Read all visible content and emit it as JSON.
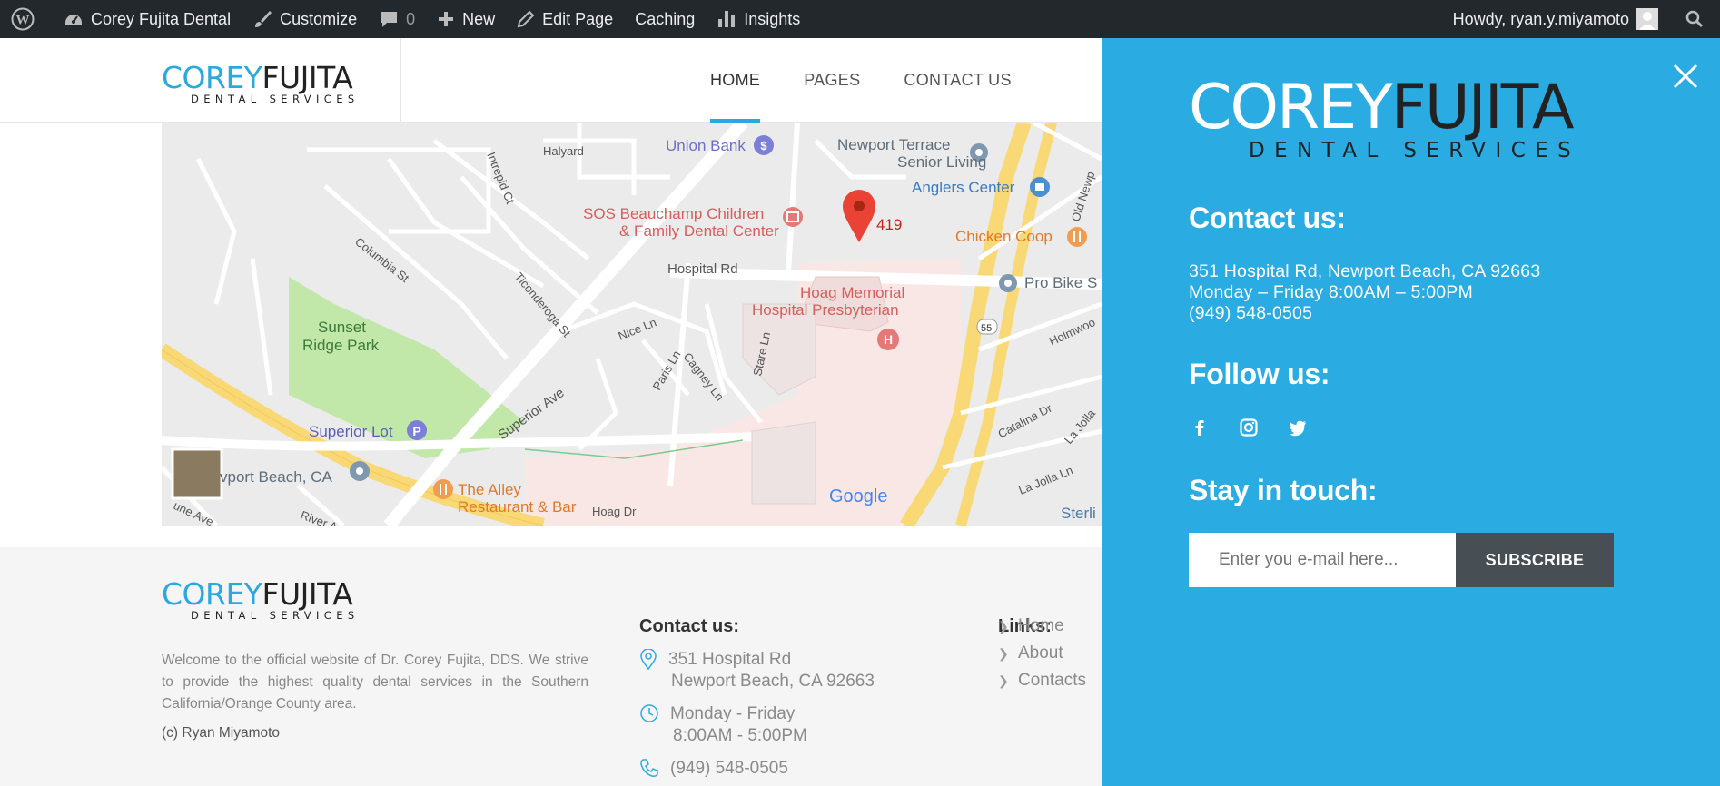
{
  "adminbar": {
    "site_name": "Corey Fujita Dental",
    "customize": "Customize",
    "comments_count": "0",
    "new": "New",
    "edit_page": "Edit Page",
    "caching": "Caching",
    "insights": "Insights",
    "howdy": "Howdy, ryan.y.miyamoto"
  },
  "logo": {
    "first": "COREY",
    "last": "FUJITA",
    "tagline": "DENTAL SERVICES"
  },
  "nav": {
    "items": [
      "HOME",
      "PAGES",
      "CONTACT US"
    ],
    "active": "HOME"
  },
  "map": {
    "labels": {
      "halyard": "Halyard",
      "union_bank": "Union Bank",
      "newport_terrace": "Newport Terrace",
      "senior_living": "Senior Living",
      "anglers": "Anglers Center",
      "old_newport": "Old Newp",
      "intrepid": "Intrepid Ct",
      "sos1": "SOS Beauchamp Children",
      "sos2": "& Family Dental Center",
      "marker": "419",
      "chicken": "Chicken Coop",
      "columbia": "Columbia St",
      "ticonderoga": "Ticonderoga St",
      "hospital_rd": "Hospital Rd",
      "pro_bike": "Pro Bike S",
      "hoag1": "Hoag Memorial",
      "hoag2": "Hospital Presbyterian",
      "sunset1": "Sunset",
      "sunset2": "Ridge Park",
      "nice": "Nice Ln",
      "paris": "Paris Ln",
      "cagney": "Cagney Ln",
      "stare": "Stare Ln",
      "superior_ave": "Superior Ave",
      "route": "55",
      "holmwood": "Holmwoo",
      "catalina": "Catalina Dr",
      "la_jolla": "La Jolla",
      "superior_lot": "Superior Lot",
      "newport_beach": "vport Beach, CA",
      "la_jolla_ln": "La Jolla Ln",
      "alley1": "The Alley",
      "alley2": "Restaurant & Bar",
      "hoag_dr": "Hoag Dr",
      "google": "Google",
      "sterli": "Sterli",
      "river": "River A",
      "ne_ave": "une Ave"
    }
  },
  "footer": {
    "description": "Welcome to the official website of Dr. Corey Fujita, DDS. We strive to provide the highest quality dental services in the Southern California/Orange County area.",
    "copyright": "(c) Ryan Miyamoto",
    "contact_heading": "Contact us:",
    "address_line1": "351 Hospital Rd",
    "address_line2": "Newport Beach, CA 92663",
    "hours_line1": "Monday - Friday",
    "hours_line2": "8:00AM - 5:00PM",
    "phone": "(949) 548-0505",
    "links_heading": "Links:",
    "links": [
      "Home",
      "About",
      "Contacts"
    ]
  },
  "panel": {
    "contact_heading": "Contact us:",
    "address": "351 Hospital Rd, Newport Beach, CA 92663",
    "hours": "Monday – Friday 8:00AM – 5:00PM",
    "phone": "(949) 548-0505",
    "follow_heading": "Follow us:",
    "stay_heading": "Stay in touch:",
    "email_placeholder": "Enter you e-mail here...",
    "subscribe_label": "SUBSCRIBE"
  },
  "colors": {
    "accent": "#2aabe2",
    "admin_bar": "#23282d",
    "footer_bg": "#f5f5f5",
    "subscribe_bg": "#474f55"
  }
}
